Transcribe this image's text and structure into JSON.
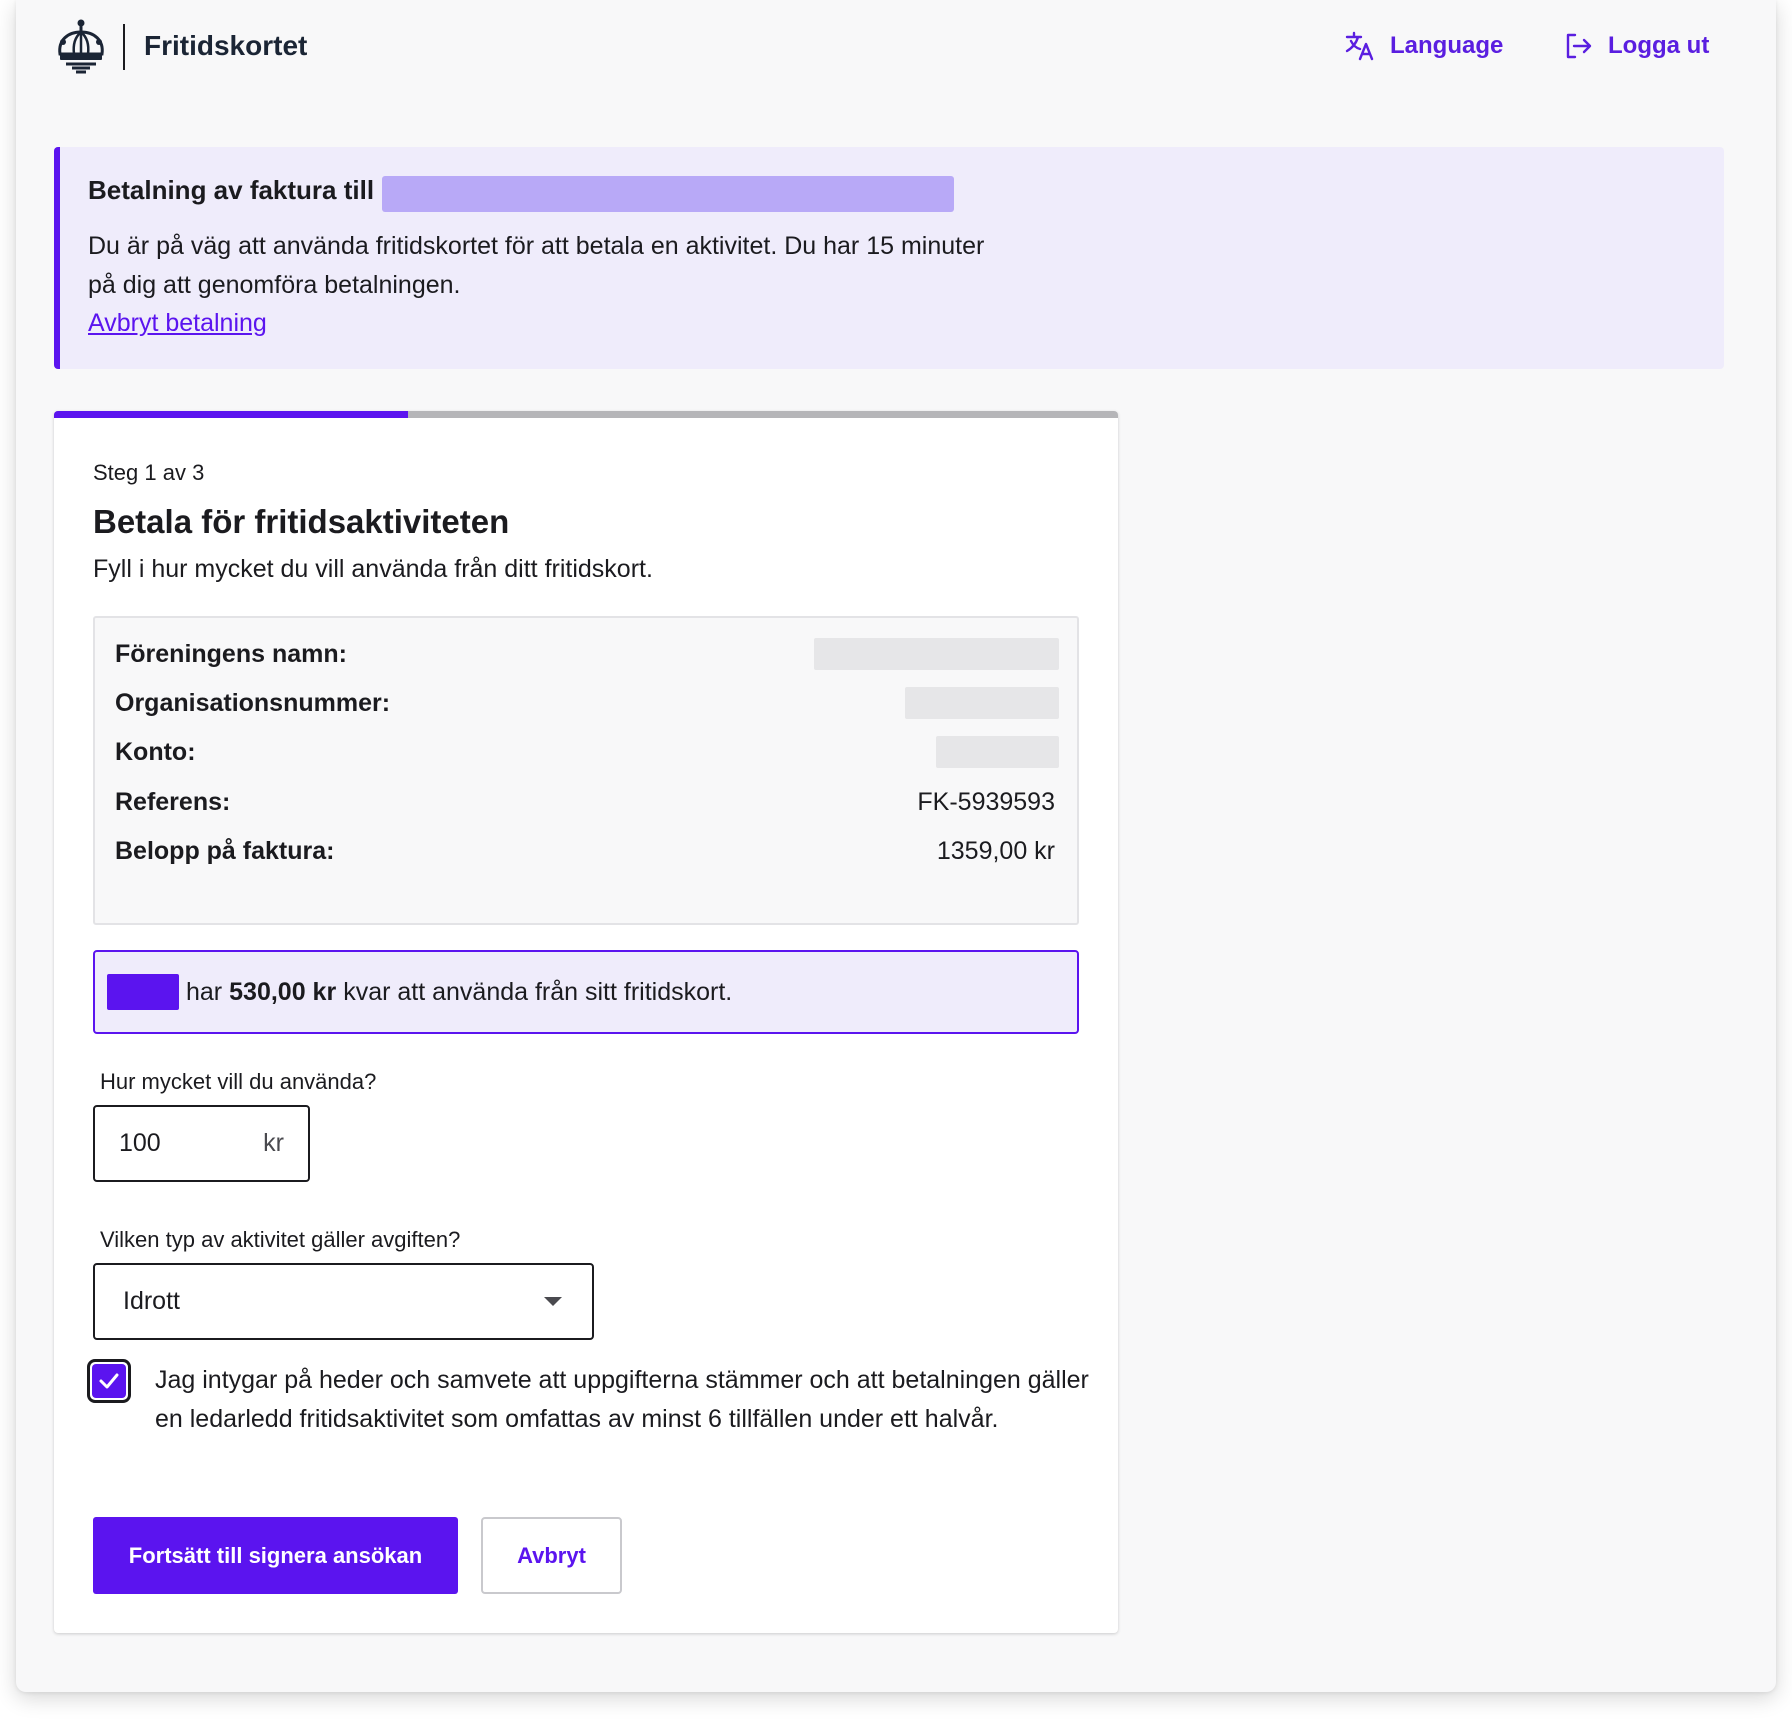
{
  "header": {
    "brand": "Fritidskortet",
    "language_label": "Language",
    "logout_label": "Logga ut"
  },
  "notice": {
    "title": "Betalning av faktura till",
    "text": "Du är på väg att använda fritidskortet för att betala en aktivitet. Du har 15 minuter på dig att genomföra betalningen.",
    "cancel_link": "Avbryt betalning"
  },
  "card": {
    "progress_fraction": 0.333,
    "step": "Steg 1 av 3",
    "title": "Betala för fritidsaktiviteten",
    "subtitle": "Fyll i hur mycket du vill använda från ditt fritidskort."
  },
  "invoice": {
    "rows": [
      {
        "label": "Föreningens namn:",
        "value": ""
      },
      {
        "label": "Organisationsnummer:",
        "value": ""
      },
      {
        "label": "Konto:",
        "value": ""
      },
      {
        "label": "Referens:",
        "value": "FK-5939593"
      },
      {
        "label": "Belopp på faktura:",
        "value": "1359,00 kr"
      }
    ]
  },
  "balance": {
    "prefix": "har",
    "amount": "530,00 kr",
    "suffix": "kvar att använda från sitt fritidskort."
  },
  "form": {
    "amount_label": "Hur mycket vill du använda?",
    "amount_value": "100",
    "amount_unit": "kr",
    "type_label": "Vilken typ av aktivitet gäller avgiften?",
    "type_value": "Idrott",
    "consent_checked": true,
    "consent_text": "Jag intygar på heder och samvete att uppgifterna stämmer och att betalningen gäller en ledarledd fritidsaktivitet som omfattas av minst 6 tillfällen under ett halvår."
  },
  "actions": {
    "primary": "Fortsätt till signera ansökan",
    "secondary": "Avbryt"
  },
  "colors": {
    "accent": "#5b14ef",
    "notice_bg": "#efecfb"
  }
}
